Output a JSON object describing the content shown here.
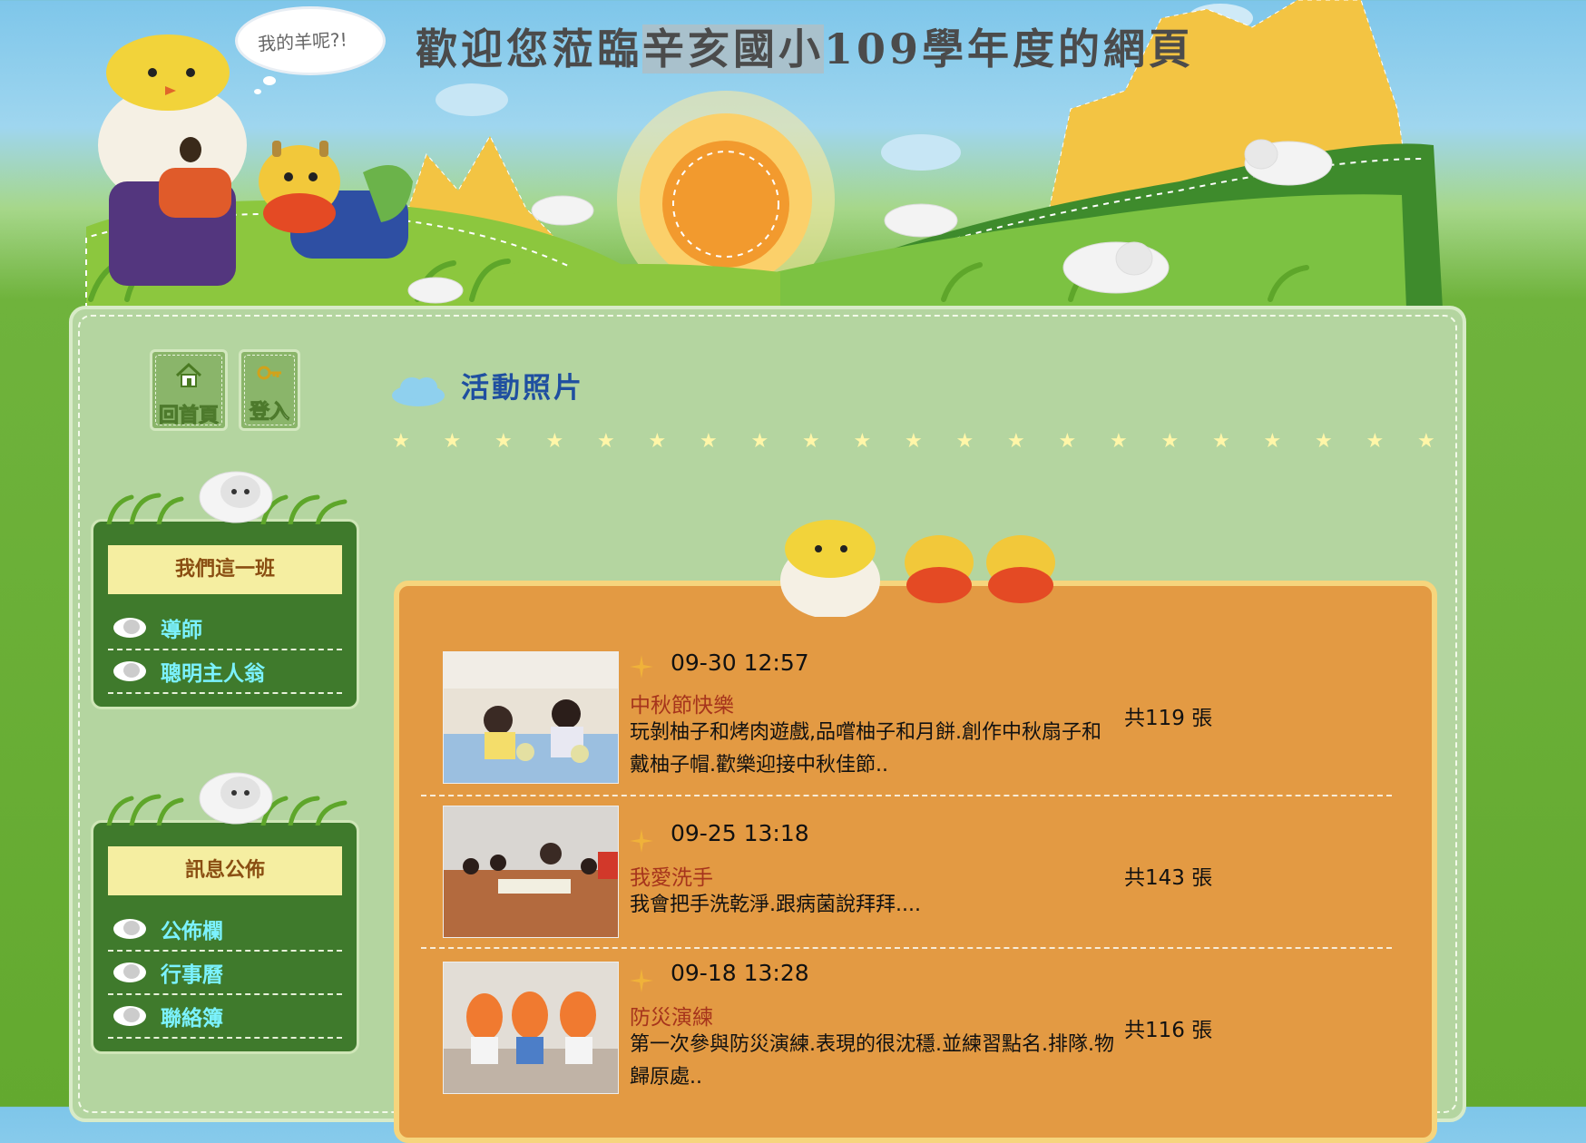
{
  "header": {
    "bubble_text": "我的羊呢?!",
    "title_pre": "歡迎您蒞臨",
    "title_highlight": "辛亥國小",
    "title_post": "109學年度的網頁"
  },
  "top_buttons": {
    "home_label": "回首頁",
    "login_label": "登入"
  },
  "sidebar": {
    "box1": {
      "heading": "我們這一班",
      "links": [
        "導師",
        "聰明主人翁"
      ]
    },
    "box2": {
      "heading": "訊息公佈",
      "links": [
        "公佈欄",
        "行事曆",
        "聯絡簿"
      ]
    }
  },
  "main": {
    "section_title": "活動照片",
    "albums": [
      {
        "date": "09-30 12:57",
        "title": "中秋節快樂",
        "desc": "玩剝柚子和烤肉遊戲,品嚐柚子和月餅.創作中秋扇子和戴柚子帽.歡樂迎接中秋佳節..",
        "count": "共119 張"
      },
      {
        "date": "09-25 13:18",
        "title": "我愛洗手",
        "desc": "我會把手洗乾淨.跟病菌說拜拜....",
        "count": "共143 張"
      },
      {
        "date": "09-18 13:28",
        "title": "防災演練",
        "desc": "第一次參與防災演練.表現的很沈穩.並練習點名.排隊.物歸原處..",
        "count": "共116 張"
      }
    ]
  },
  "colors": {
    "panel": "#b4d5a0",
    "sidebar_box": "#3f7a2c",
    "album_box": "#e39a43",
    "link_text": "#7bf2ff",
    "album_title": "#a6341c"
  }
}
